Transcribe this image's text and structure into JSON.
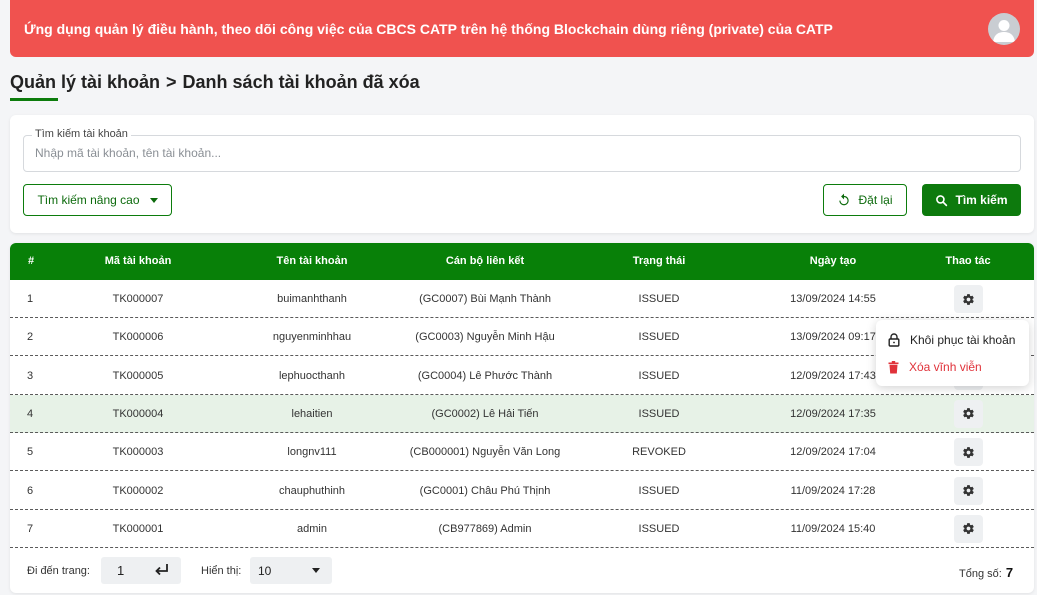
{
  "header": {
    "app_title": "Ứng dụng quản lý điều hành, theo dõi công việc của CBCS CATP trên hệ thống Blockchain dùng riêng (private) của CATP",
    "avatar_icon": "user-avatar-icon",
    "accent_color": "#f0524f"
  },
  "breadcrumb": {
    "root": "Quản lý tài khoản",
    "separator": ">",
    "current": "Danh sách tài khoản đã xóa"
  },
  "search": {
    "legend": "Tìm kiếm tài khoản",
    "placeholder": "Nhập mã tài khoản, tên tài khoản...",
    "value": "",
    "advanced_label": "Tìm kiếm nâng cao",
    "reset_label": "Đặt lại",
    "search_label": "Tìm kiếm",
    "brand_color": "#0c7c0c"
  },
  "table": {
    "columns": [
      "#",
      "Mã tài khoản",
      "Tên tài khoản",
      "Cán bộ liên kết",
      "Trạng thái",
      "Ngày tạo",
      "Thao tác"
    ],
    "rows": [
      {
        "idx": "1",
        "code": "TK000007",
        "name": "buimanhthanh",
        "officer": "(GC0007) Bùi Mạnh Thành",
        "status": "ISSUED",
        "created": "13/09/2024 14:55"
      },
      {
        "idx": "2",
        "code": "TK000006",
        "name": "nguyenminhhau",
        "officer": "(GC0003) Nguyễn Minh Hậu",
        "status": "ISSUED",
        "created": "13/09/2024 09:17"
      },
      {
        "idx": "3",
        "code": "TK000005",
        "name": "lephuocthanh",
        "officer": "(GC0004) Lê Phước Thành",
        "status": "ISSUED",
        "created": "12/09/2024 17:43"
      },
      {
        "idx": "4",
        "code": "TK000004",
        "name": "lehaitien",
        "officer": "(GC0002) Lê Hải Tiến",
        "status": "ISSUED",
        "created": "12/09/2024 17:35"
      },
      {
        "idx": "5",
        "code": "TK000003",
        "name": "longnv111",
        "officer": "(CB000001) Nguyễn Văn Long",
        "status": "REVOKED",
        "created": "12/09/2024 17:04"
      },
      {
        "idx": "6",
        "code": "TK000002",
        "name": "chauphuthinh",
        "officer": "(GC0001) Châu Phú Thịnh",
        "status": "ISSUED",
        "created": "11/09/2024 17:28"
      },
      {
        "idx": "7",
        "code": "TK000001",
        "name": "admin",
        "officer": "(CB977869) Admin",
        "status": "ISSUED",
        "created": "11/09/2024 15:40"
      }
    ],
    "highlighted_row": "4"
  },
  "context_menu": {
    "restore_label": "Khôi phục tài khoản",
    "delete_label": "Xóa vĩnh viễn",
    "delete_color": "#e0323a"
  },
  "pagination": {
    "goto_label": "Đi đến trang:",
    "goto_value": "1",
    "show_label": "Hiển thị:",
    "page_size": "10",
    "total_label": "Tổng số:",
    "total_value": "7"
  }
}
